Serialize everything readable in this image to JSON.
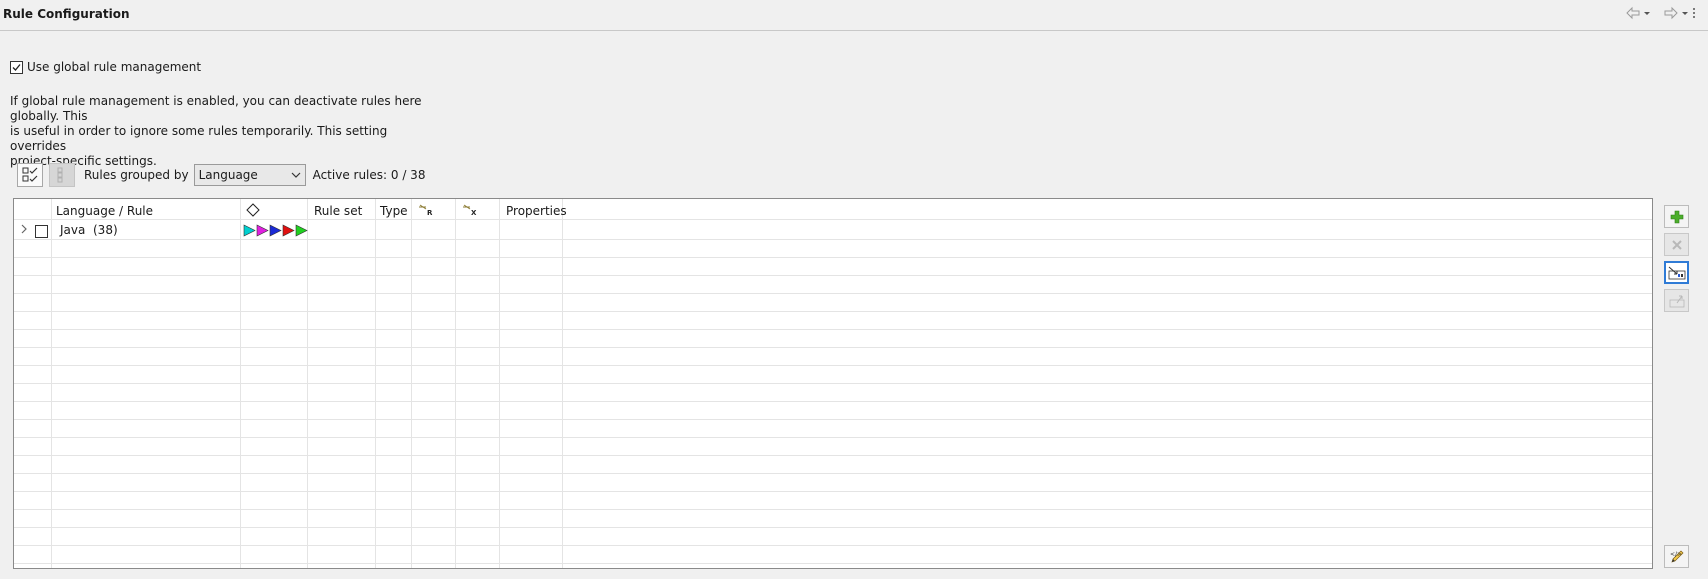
{
  "header": {
    "title": "Rule Configuration"
  },
  "global": {
    "checkbox_label": "Use global rule management",
    "checked": true,
    "description_lines": [
      "If global rule management is enabled, you can deactivate rules here globally. This",
      "is useful in order to ignore some rules temporarily. This setting overrides",
      "project-specific settings."
    ]
  },
  "toolbar": {
    "group_label": "Rules grouped by",
    "group_value": "Language",
    "active_rules": "Active rules: 0 / 38"
  },
  "table": {
    "columns": {
      "language_rule": "Language / Rule",
      "rule_set": "Rule set",
      "type": "Type",
      "properties": "Properties"
    },
    "rows": [
      {
        "label": "Java",
        "count": "(38)"
      }
    ],
    "severity_colors": [
      "#00d0d0",
      "#e020e0",
      "#1a2ad6",
      "#e01010",
      "#20d020"
    ]
  }
}
